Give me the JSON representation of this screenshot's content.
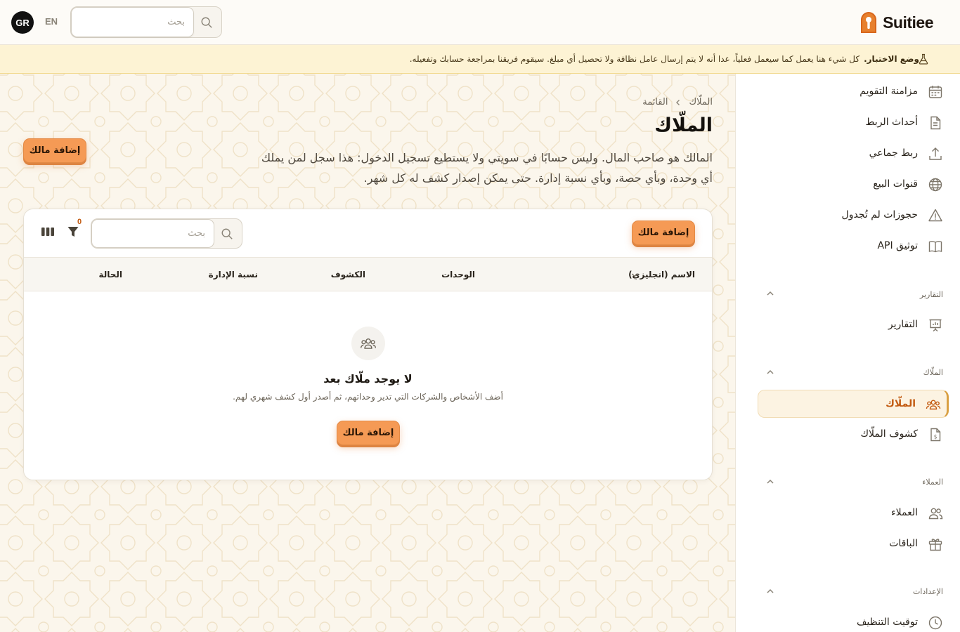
{
  "brand": {
    "name": "Suitiee"
  },
  "topbar": {
    "avatar_initials": "GR",
    "language": "EN",
    "search_placeholder": "بحث"
  },
  "banner": {
    "label": "وضع الاختبار.",
    "text": "كل شيء هنا يعمل كما سيعمل فعلياً، عدا أنه لا يتم إرسال عامل نظافة ولا تحصيل أي مبلغ. سيقوم فريقنا بمراجعة حسابك وتفعيله."
  },
  "sidebar": {
    "items_top": [
      {
        "label": "مزامنة التقويم",
        "icon": "calendar-icon"
      },
      {
        "label": "أحداث الربط",
        "icon": "document-icon"
      },
      {
        "label": "ربط جماعي",
        "icon": "upload-icon"
      },
      {
        "label": "قنوات البيع",
        "icon": "globe-icon"
      },
      {
        "label": "حجوزات لم تُجدول",
        "icon": "warning-icon"
      },
      {
        "label": "توثيق API",
        "icon": "book-icon"
      }
    ],
    "sections": [
      {
        "title": "التقارير",
        "items": [
          {
            "label": "التقارير",
            "icon": "presentation-chart-icon"
          }
        ]
      },
      {
        "title": "الملّاك",
        "items": [
          {
            "label": "الملّاك",
            "icon": "users-group-icon",
            "active": true
          },
          {
            "label": "كشوف الملّاك",
            "icon": "invoice-dollar-icon"
          }
        ]
      },
      {
        "title": "العملاء",
        "items": [
          {
            "label": "العملاء",
            "icon": "users-icon"
          },
          {
            "label": "الباقات",
            "icon": "gift-icon"
          }
        ]
      },
      {
        "title": "الإعدادات",
        "items": [
          {
            "label": "توقيت التنظيف",
            "icon": "clock-icon"
          }
        ]
      }
    ]
  },
  "main": {
    "breadcrumb": {
      "parent": "القائمة",
      "current": "الملّاك"
    },
    "title": "الملّاك",
    "description": "المالك هو صاحب المال. وليس حسابًا في سويتي ولا يستطيع تسجيل الدخول: هذا سجل لمن يملك أي وحدة، وبأي حصة، وبأي نسبة إدارة. حتى يمكن إصدار كشف له كل شهر.",
    "add_button": "إضافة مالك"
  },
  "table": {
    "add_button": "إضافة مالك",
    "search_placeholder": "بحث",
    "filter_count": "0",
    "columns": [
      "الاسم (انجليزي)",
      "الوحدات",
      "الكشوف",
      "نسبة الإدارة",
      "الحالة"
    ],
    "empty": {
      "title": "لا يوجد ملّاك بعد",
      "subtitle": "أضف الأشخاص والشركات التي تدير وحداتهم، ثم أصدر أول كشف شهري لهم.",
      "button": "إضافة مالك"
    }
  },
  "colors": {
    "accent": "#f59a55",
    "active_text": "#c25a10",
    "banner_bg": "#fdf3d4"
  }
}
